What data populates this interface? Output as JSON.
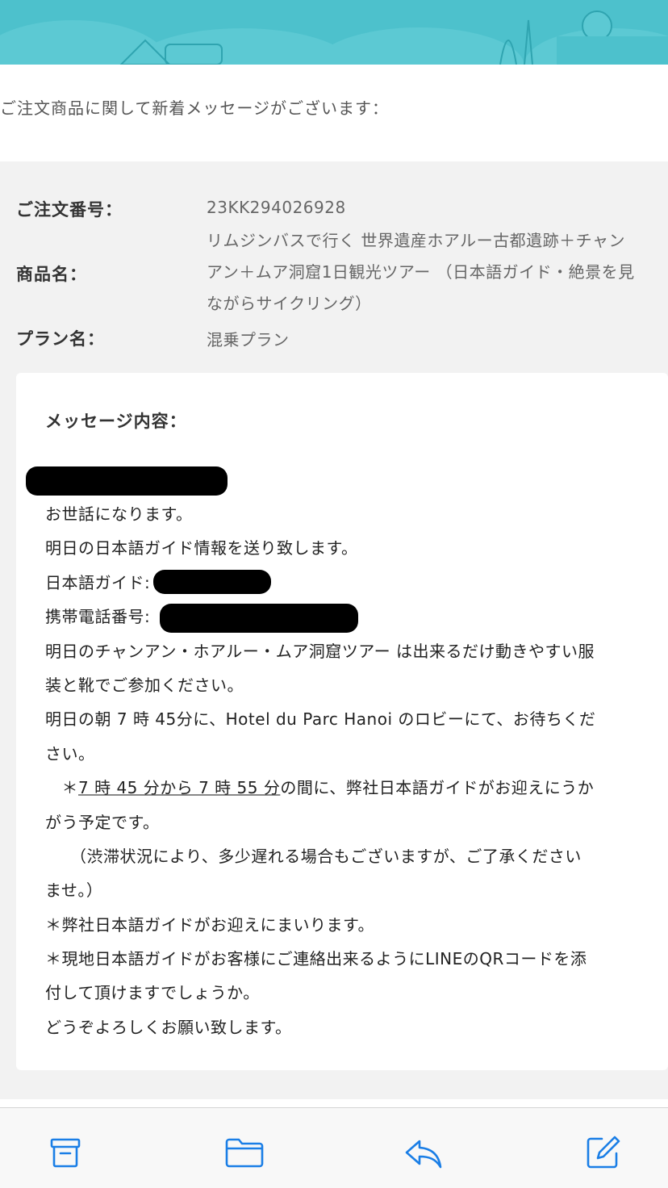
{
  "intro_text": "ご注文商品に関して新着メッセージがございます：",
  "order": {
    "order_number_label": "ご注文番号：",
    "order_number": "23KK294026928",
    "product_label": "商品名：",
    "product_lines": [
      "リムジンバスで行く 世界遺産ホアルー古都遺跡＋チャン",
      "アン＋ムア洞窟1日観光ツアー （日本語ガイド・絶景を見",
      "ながらサイクリング）"
    ],
    "plan_label": "プラン名：",
    "plan_value": "混乗プラン"
  },
  "message": {
    "heading": "メッセージ内容：",
    "lines": [
      "お世話になります。",
      "明日の日本語ガイド情報を送り致します。",
      "日本語ガイド:",
      "携帯電話番号:",
      "明日のチャンアン・ホアルー・ムア洞窟ツアー は出来るだけ動きやすい服",
      "装と靴でご参加ください。",
      "明日の朝 7 時 45分に、Hotel du Parc Hanoi のロビーにて、お待ちくだ",
      "さい。",
      "　＊",
      "がう予定です。",
      "　　（渋滞状況により、多少遅れる場合もございますが、ご了承ください",
      "ませ。）",
      "＊弊社日本語ガイドがお迎えにまいります。",
      "＊現地日本語ガイドがお客様にご連絡出来るようにLINEのQRコードを添",
      "付して頂けますでしょうか。",
      "どうぞよろしくお願い致します。"
    ],
    "pickup_underlined": "7 時 45 分から 7 時 55 分",
    "pickup_rest": "の間に、弊社日本語ガイドがお迎えにうか"
  },
  "toolbar": {
    "icons": [
      "archive-icon",
      "folder-icon",
      "reply-icon",
      "compose-icon"
    ]
  },
  "colors": {
    "banner": "#4dc1cc",
    "accent": "#1a7ee6",
    "panel": "#f2f2f2"
  }
}
